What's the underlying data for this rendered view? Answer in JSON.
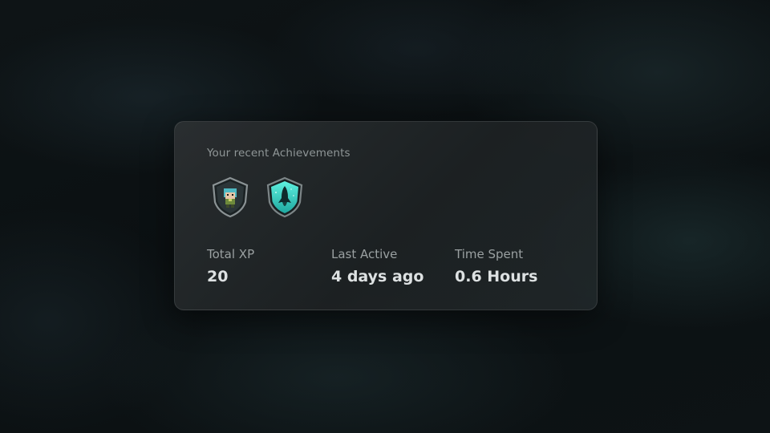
{
  "achievements": {
    "title": "Your recent Achievements",
    "badges": [
      {
        "icon": "pixel-character-shield-icon",
        "color": "#3a4c52"
      },
      {
        "icon": "rocket-shield-icon",
        "color": "#3fe0cf"
      }
    ]
  },
  "stats": {
    "total_xp": {
      "label": "Total XP",
      "value": "20"
    },
    "last_active": {
      "label": "Last Active",
      "value": "4 days ago"
    },
    "time_spent": {
      "label": "Time Spent",
      "value": "0.6 Hours"
    }
  }
}
